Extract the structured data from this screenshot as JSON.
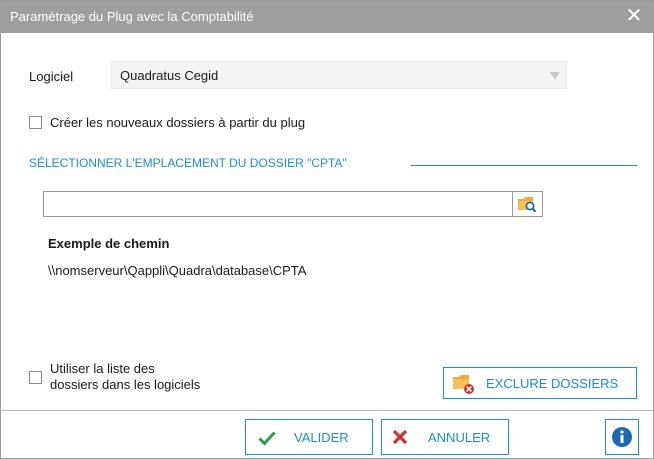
{
  "dialog": {
    "title": "Paramétrage du Plug avec la Comptabilité",
    "close_glyph": "✕"
  },
  "logiciel": {
    "label": "Logiciel",
    "selected": "Quadratus Cegid"
  },
  "create_folders": {
    "label": "Créer les nouveaux dossiers à partir du plug",
    "checked": false
  },
  "section": {
    "title": "SÉLECTIONNER L'EMPLACEMENT DU DOSSIER \"CPTA\""
  },
  "path_input": {
    "value": ""
  },
  "example": {
    "title": "Exemple de chemin",
    "path": "\\\\nomserveur\\Qappli\\Quadra\\database\\CPTA"
  },
  "use_list": {
    "label_line1": "Utiliser la liste des",
    "label_line2": "dossiers dans les logiciels",
    "checked": false
  },
  "buttons": {
    "exclude": "EXCLURE DOSSIERS",
    "valider": "VALIDER",
    "annuler": "ANNULER"
  },
  "icons": {
    "close": "close-icon",
    "dropdown": "chevron-down-icon",
    "browse": "folder-search-icon",
    "exclude": "folder-delete-icon",
    "valider": "checkmark-icon",
    "annuler": "cross-icon",
    "info": "info-icon"
  },
  "colors": {
    "accent": "#1c8ec9",
    "titlebar": "#9e9e9e",
    "check_green": "#2e9e4a",
    "cross_red": "#d32f2f",
    "folder": "#f2a93b"
  }
}
